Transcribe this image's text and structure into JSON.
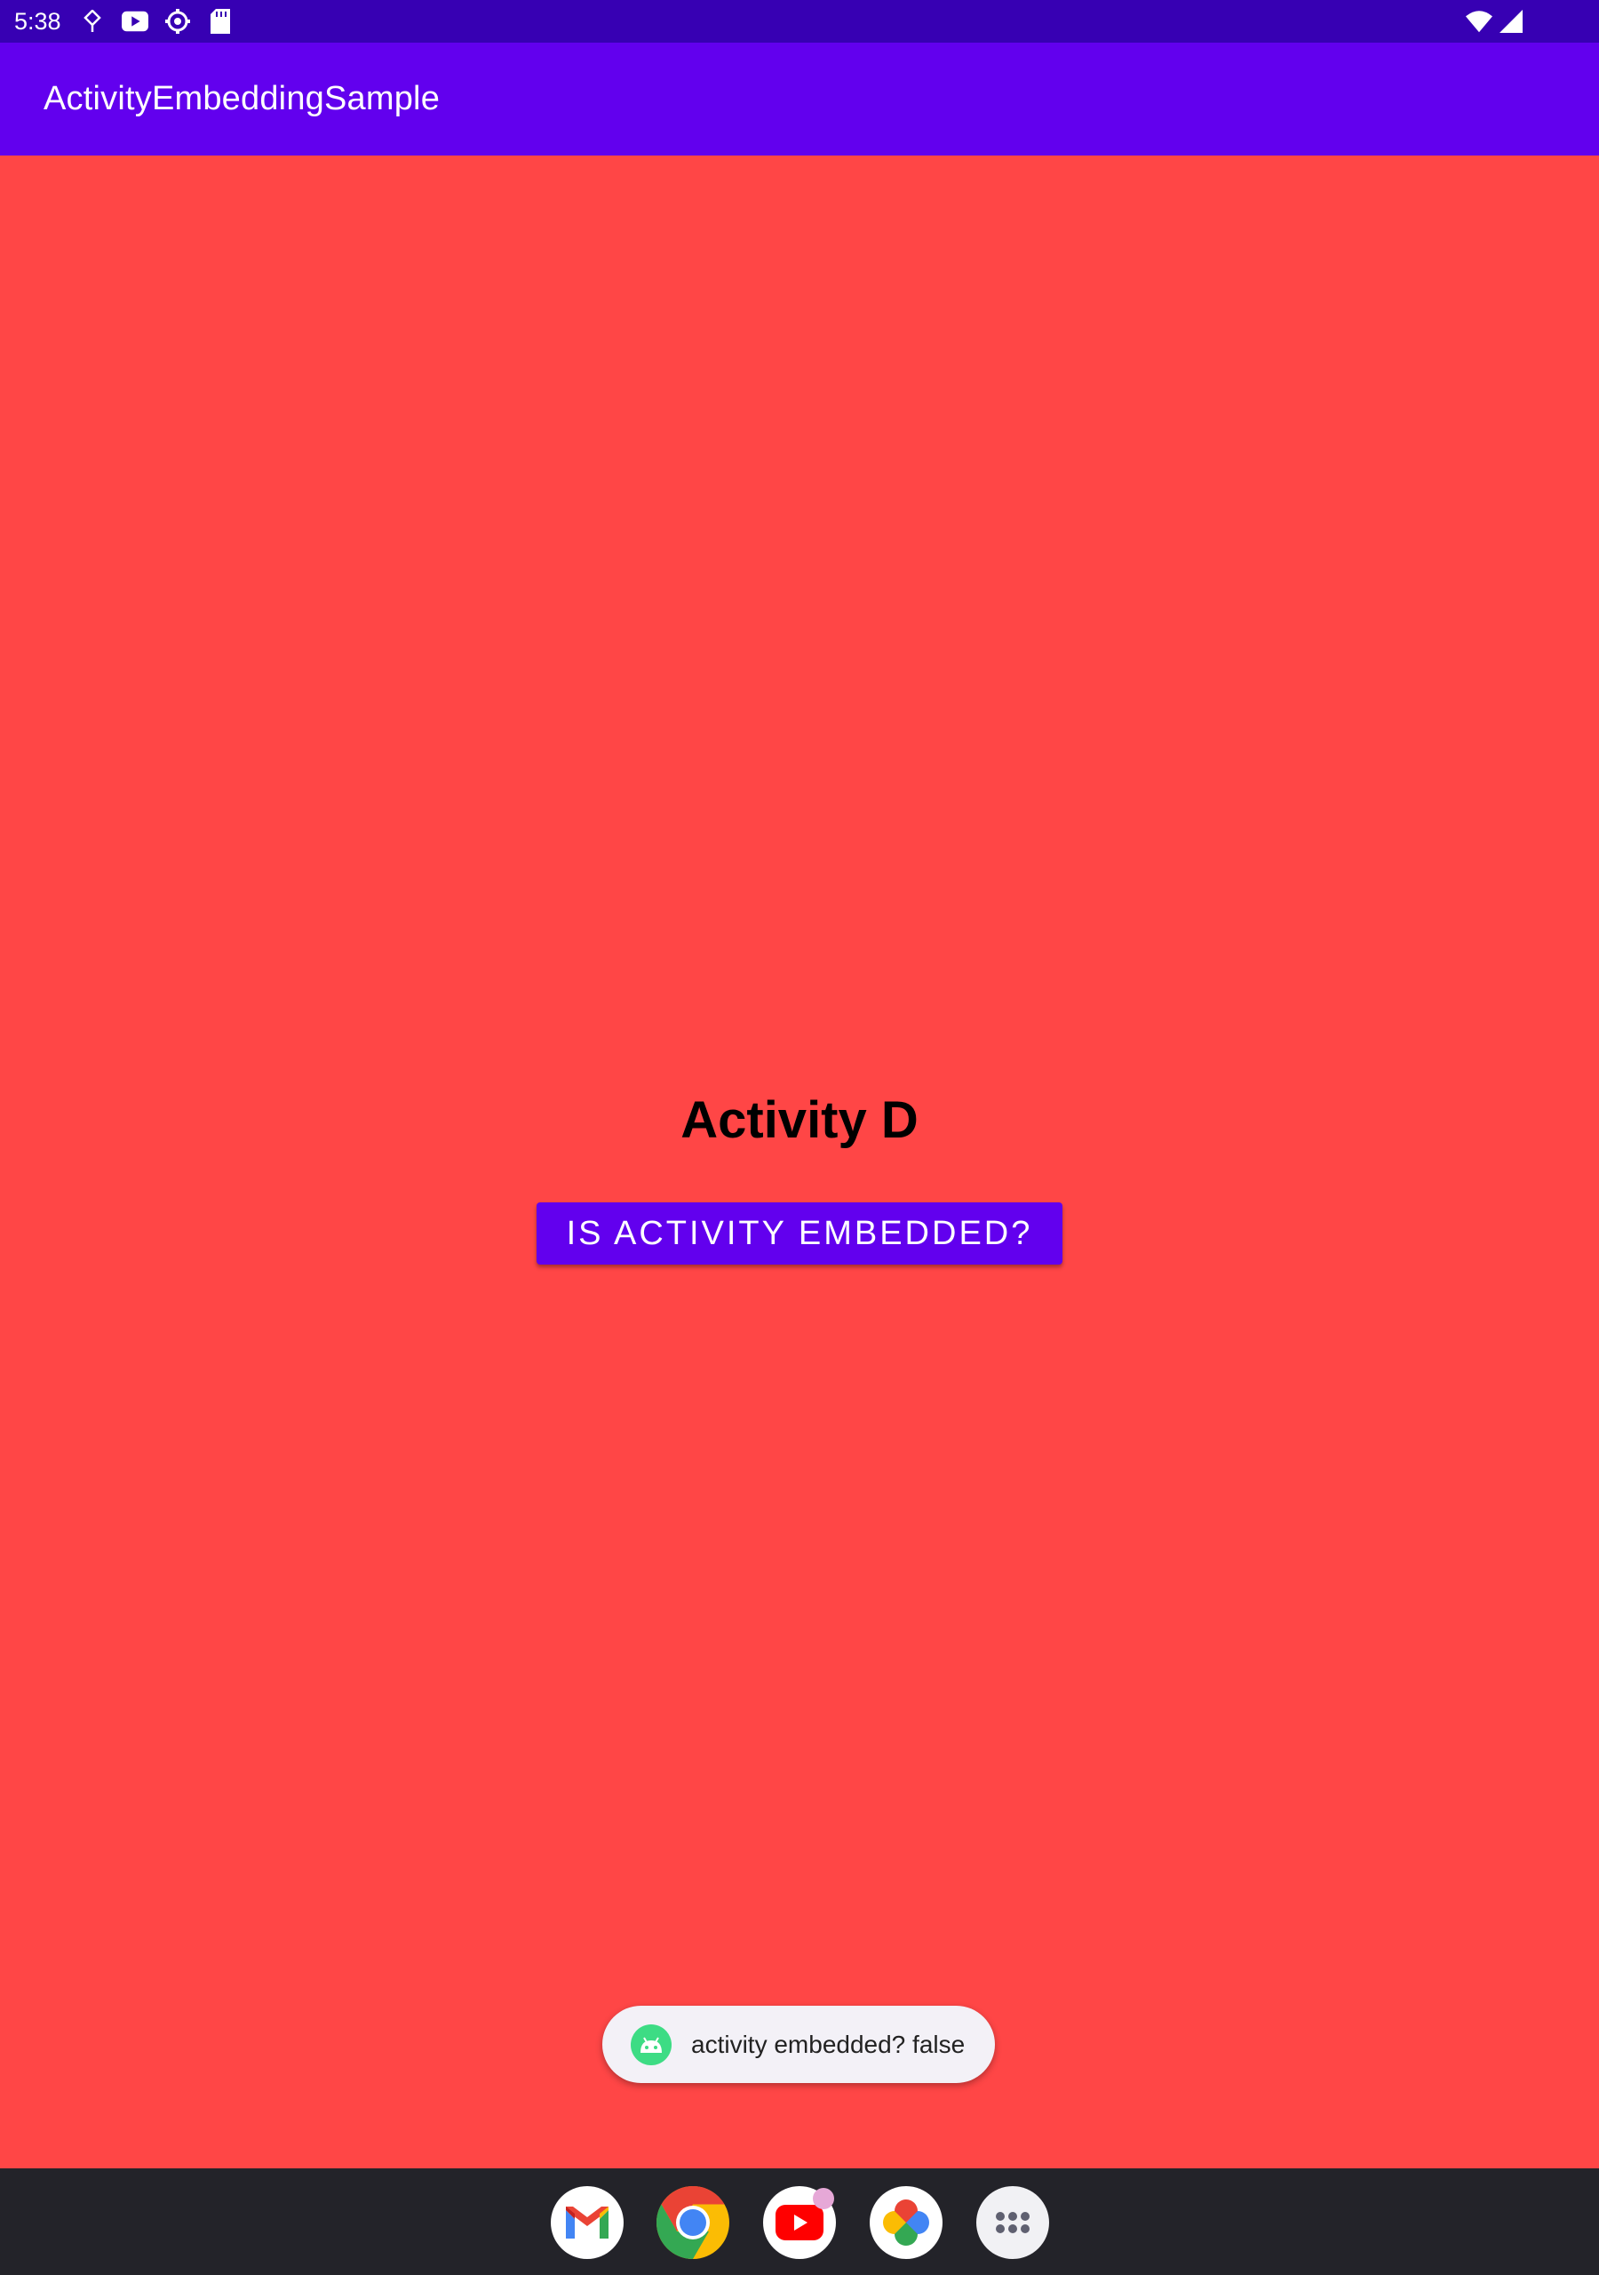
{
  "status_bar": {
    "time": "5:38",
    "left_icons": [
      "location-icon",
      "youtube-icon",
      "settings-gear-icon",
      "sd-card-icon"
    ],
    "right_icons": [
      "wifi-icon",
      "cell-signal-icon"
    ]
  },
  "app_bar": {
    "title": "ActivityEmbeddingSample"
  },
  "main": {
    "activity_title": "Activity D",
    "button_label": "IS ACTIVITY EMBEDDED?"
  },
  "toast": {
    "icon": "android-icon",
    "text": "activity embedded? false"
  },
  "taskbar": {
    "apps": [
      {
        "name": "gmail-icon"
      },
      {
        "name": "chrome-icon"
      },
      {
        "name": "youtube-icon",
        "has_badge": true
      },
      {
        "name": "photos-icon"
      },
      {
        "name": "app-drawer-icon"
      }
    ]
  },
  "colors": {
    "status_bar": "#3700b3",
    "app_bar": "#6200ee",
    "background": "#ff4646",
    "button": "#6200ee",
    "taskbar": "#232329"
  }
}
